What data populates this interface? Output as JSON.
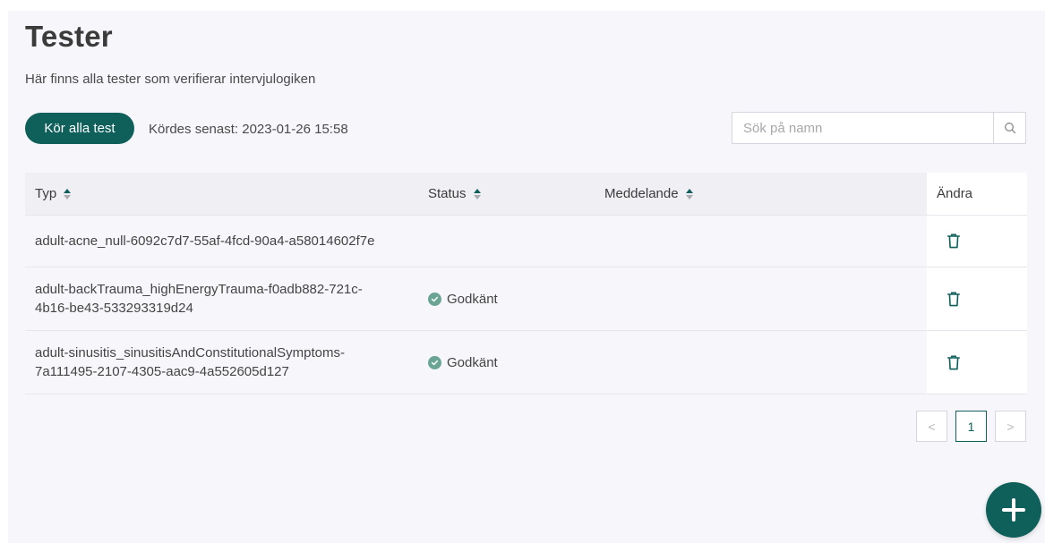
{
  "page": {
    "title": "Tester",
    "subtitle": "Här finns alla tester som verifierar intervjulogiken"
  },
  "toolbar": {
    "run_all_label": "Kör alla test",
    "last_run": "Kördes senast: 2023-01-26 15:58",
    "search_placeholder": "Sök på namn",
    "search_icon": "search-icon"
  },
  "table": {
    "headers": {
      "typ": "Typ",
      "status": "Status",
      "meddelande": "Meddelande",
      "andra": "Ändra"
    },
    "rows": [
      {
        "typ_line1": "adult-acne_null-6092c7d7-55af-4fcd-90a4-a58014602f7e",
        "typ_line2": "",
        "status": "",
        "meddelande": ""
      },
      {
        "typ_line1": "adult-backTrauma_highEnergyTrauma-f0adb882-721c-",
        "typ_line2": "4b16-be43-533293319d24",
        "status": "Godkänt",
        "meddelande": ""
      },
      {
        "typ_line1": "adult-sinusitis_sinusitisAndConstitutionalSymptoms-",
        "typ_line2": "7a111495-2107-4305-aac9-4a552605d127",
        "status": "Godkänt",
        "meddelande": ""
      }
    ]
  },
  "pagination": {
    "prev": "<",
    "current": "1",
    "next": ">"
  },
  "colors": {
    "accent": "#0f5f5a",
    "status_ok": "#6aa594",
    "background": "#f7f7fb"
  }
}
